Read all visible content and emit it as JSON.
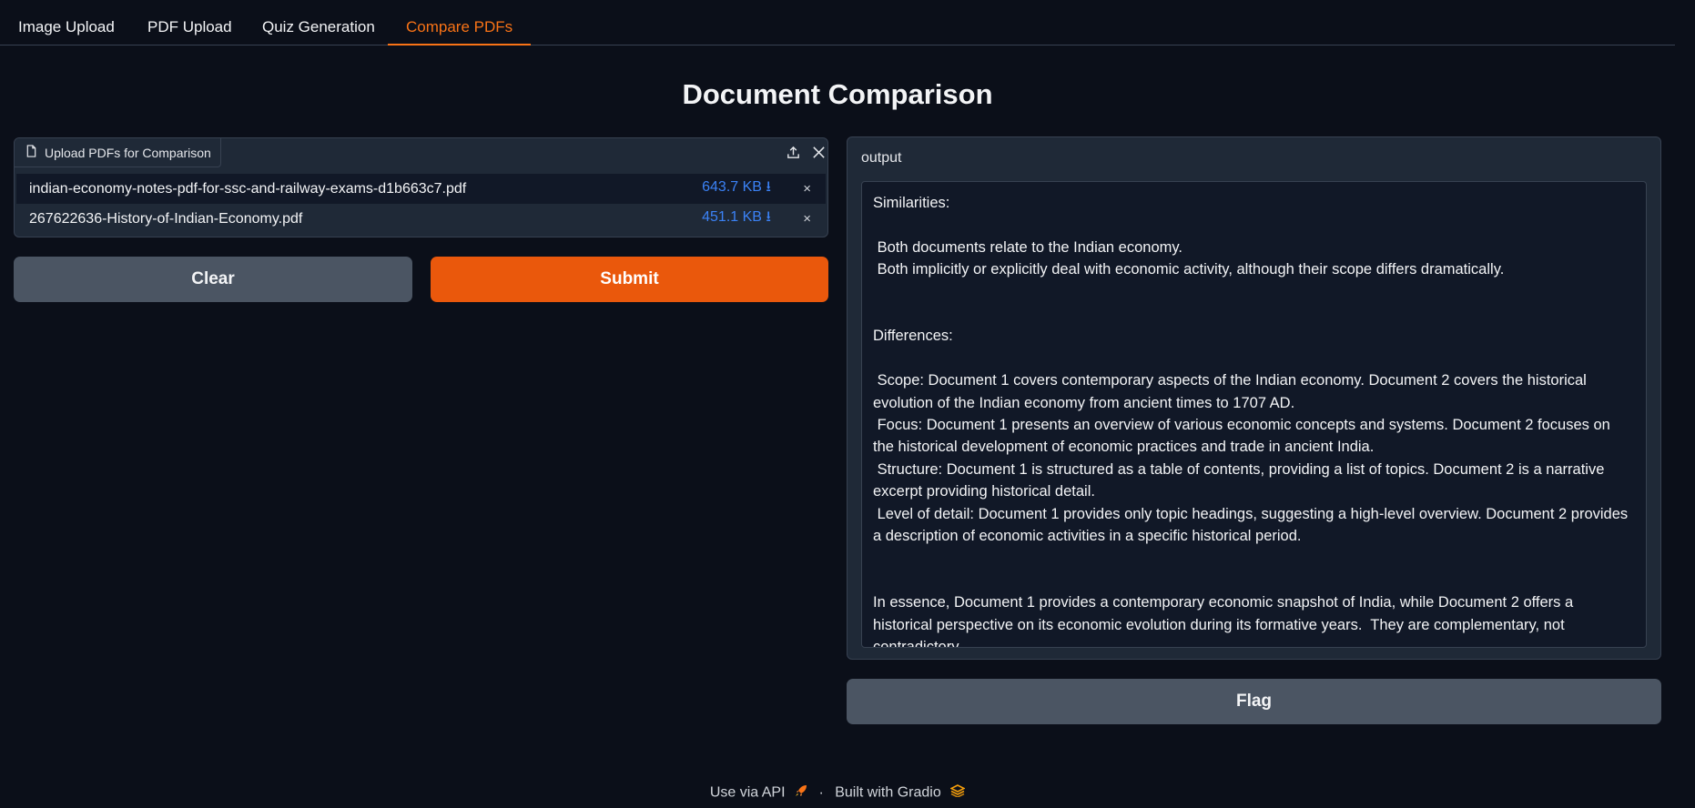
{
  "tabs": [
    {
      "label": "Image Upload",
      "active": false
    },
    {
      "label": "PDF Upload",
      "active": false
    },
    {
      "label": "Quiz Generation",
      "active": false
    },
    {
      "label": "Compare PDFs",
      "active": true
    }
  ],
  "page_title": "Document Comparison",
  "upload": {
    "label": "Upload PDFs for Comparison",
    "files": [
      {
        "name": "indian-economy-notes-pdf-for-ssc-and-railway-exams-d1b663c7.pdf",
        "size": "643.7 KB ⭳"
      },
      {
        "name": "267622636-History-of-Indian-Economy.pdf",
        "size": "451.1 KB ⭳"
      }
    ],
    "remove_symbol": "×"
  },
  "buttons": {
    "clear": "Clear",
    "submit": "Submit",
    "flag": "Flag"
  },
  "output": {
    "label": "output",
    "text": "Similarities:\n\n Both documents relate to the Indian economy.\n Both implicitly or explicitly deal with economic activity, although their scope differs dramatically.\n\n\nDifferences:\n\n Scope: Document 1 covers contemporary aspects of the Indian economy. Document 2 covers the historical evolution of the Indian economy from ancient times to 1707 AD.\n Focus: Document 1 presents an overview of various economic concepts and systems. Document 2 focuses on the historical development of economic practices and trade in ancient India.\n Structure: Document 1 is structured as a table of contents, providing a list of topics. Document 2 is a narrative excerpt providing historical detail.\n Level of detail: Document 1 provides only topic headings, suggesting a high-level overview. Document 2 provides a description of economic activities in a specific historical period.\n\n\nIn essence, Document 1 provides a contemporary economic snapshot of India, while Document 2 offers a historical perspective on its economic evolution during its formative years.  They are complementary, not contradictory."
  },
  "footer": {
    "api_link": "Use via API",
    "separator": "·",
    "built_with": "Built with Gradio"
  },
  "colors": {
    "accent": "#f97316",
    "primary_button": "#ea580c",
    "secondary_button": "#4b5563",
    "background": "#0b0f19",
    "file_size_link": "#3b82f6"
  },
  "icons": [
    "file-icon",
    "upload-icon",
    "close-icon",
    "rocket-icon",
    "gradio-logo-icon"
  ]
}
